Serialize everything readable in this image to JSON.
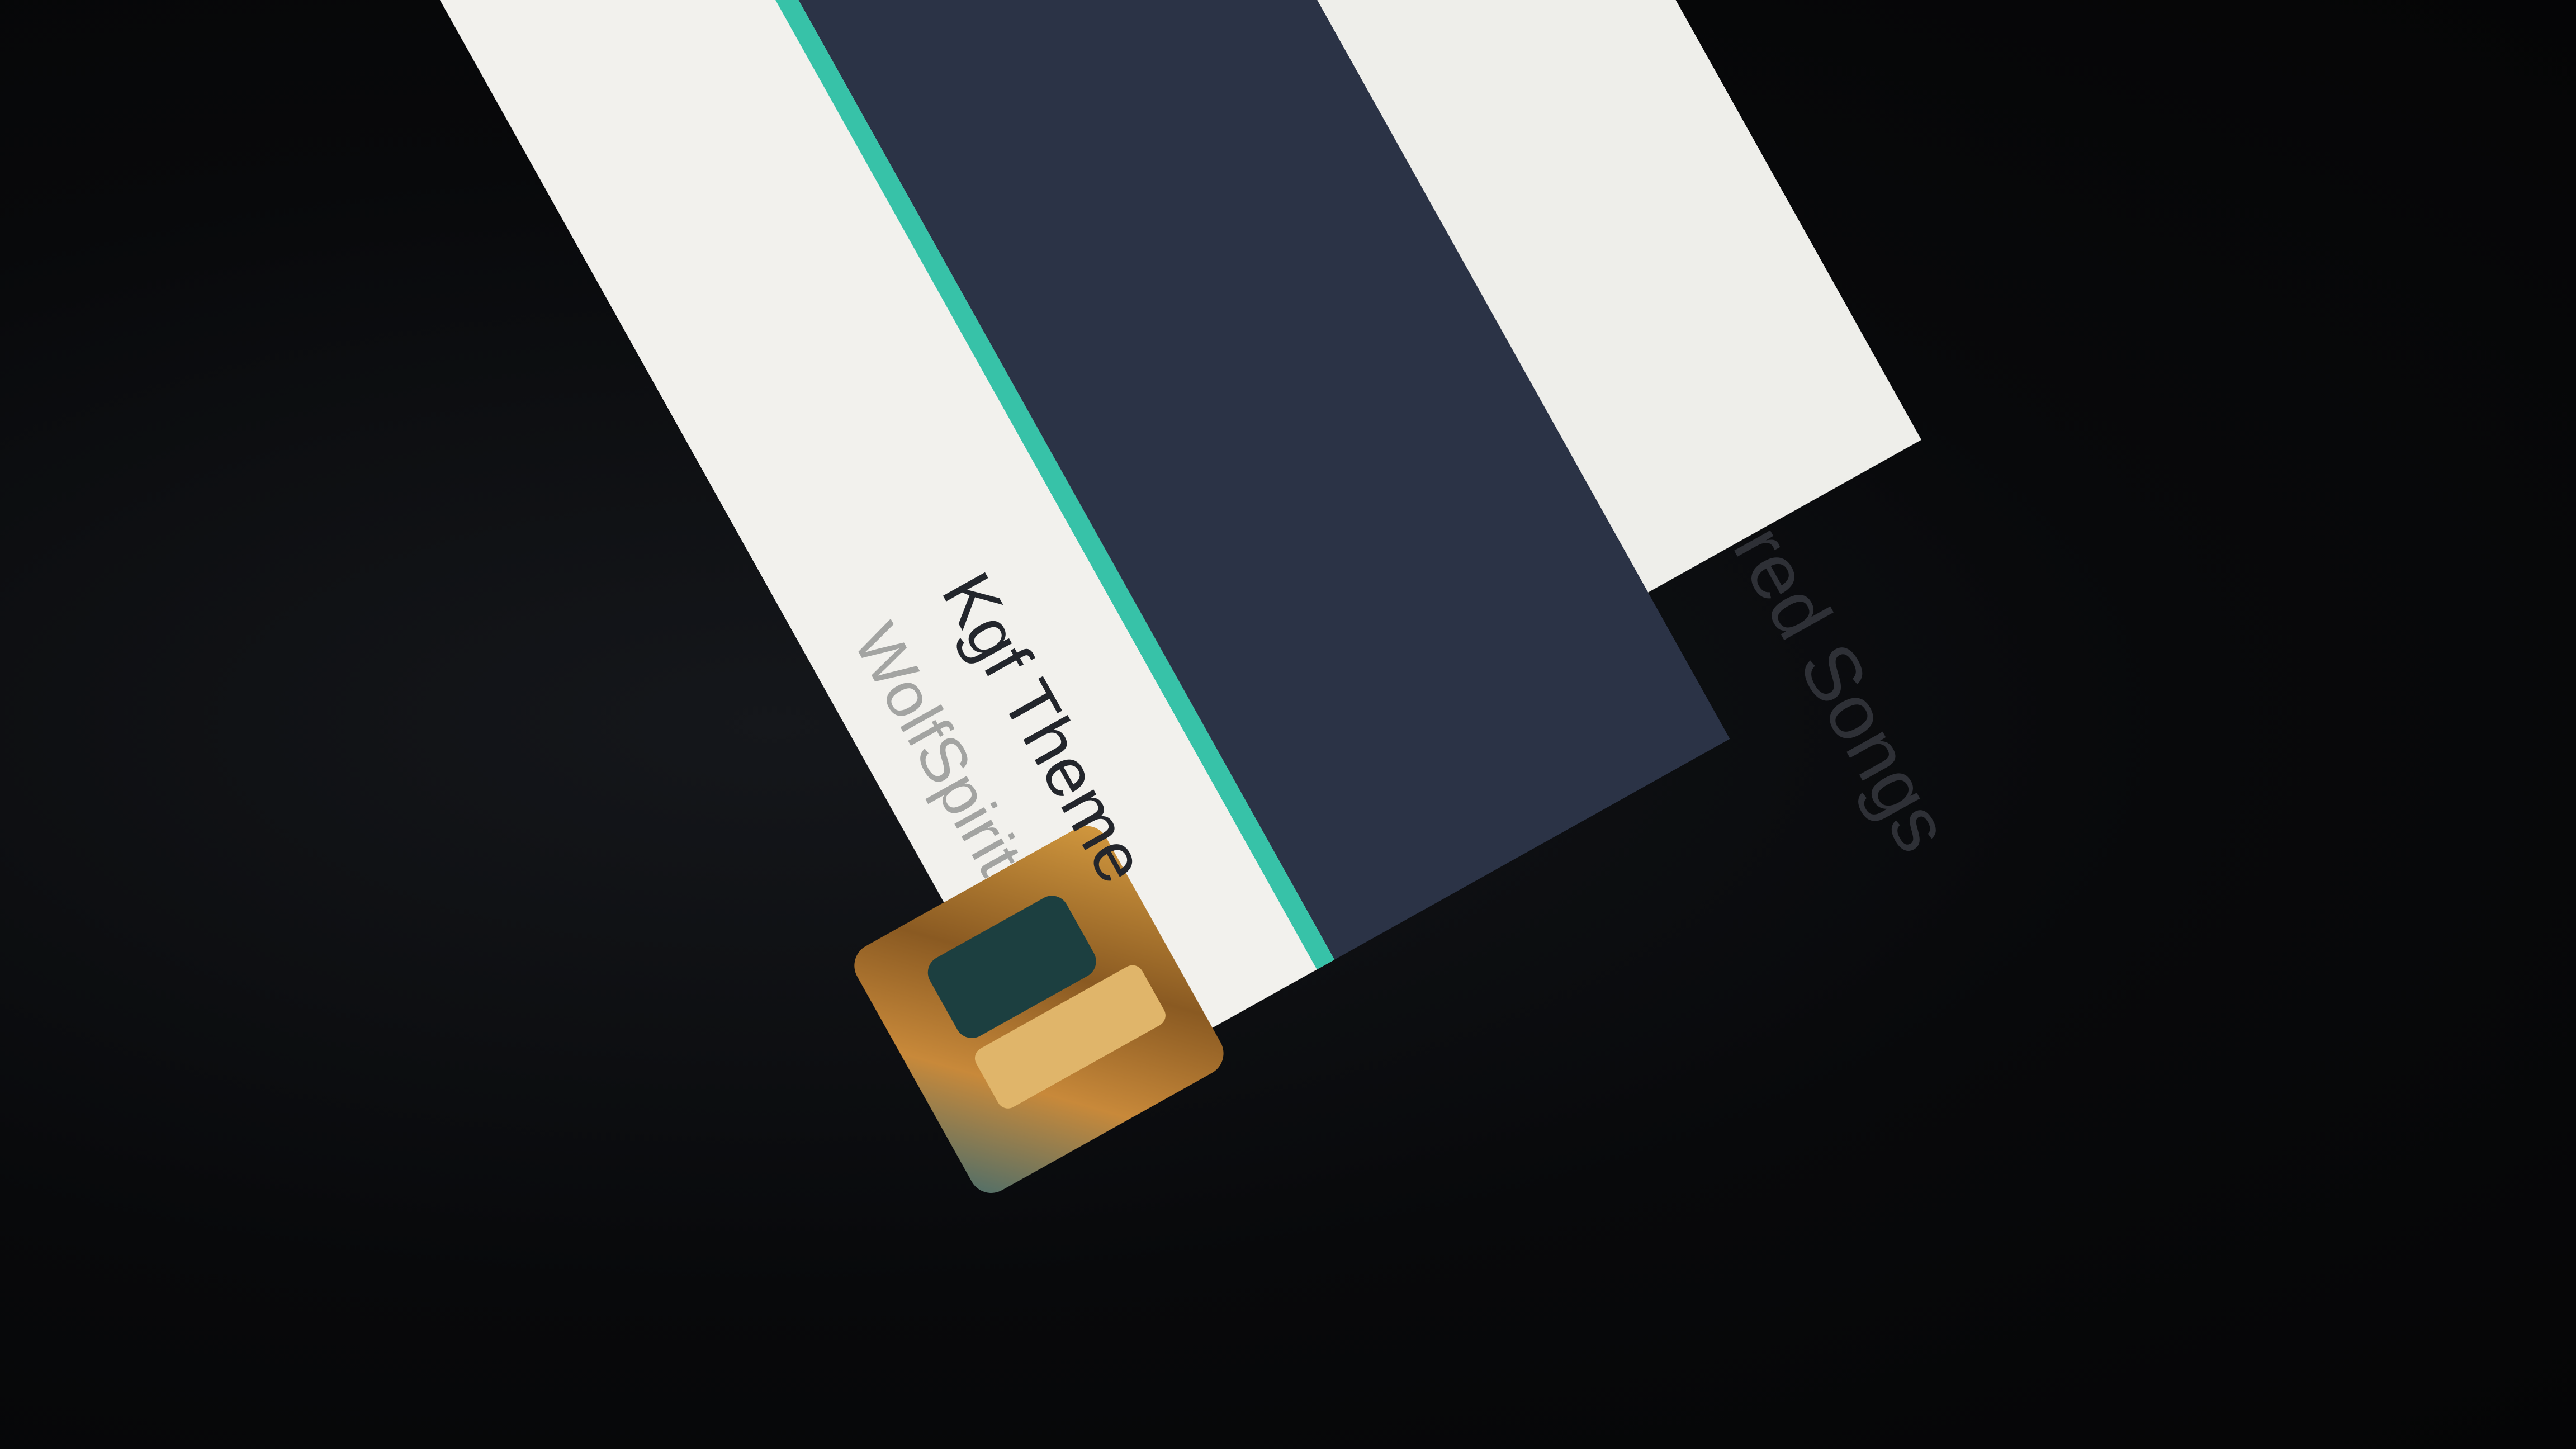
{
  "sidebar": {
    "label": "red Songs"
  },
  "now_playing": {
    "title": "Kgf Theme",
    "artist": "WolfSpirit",
    "progress": 1.0
  },
  "colors": {
    "navy": "#2b3346",
    "accent": "#37c2a8",
    "panel": "#eeeeea"
  }
}
